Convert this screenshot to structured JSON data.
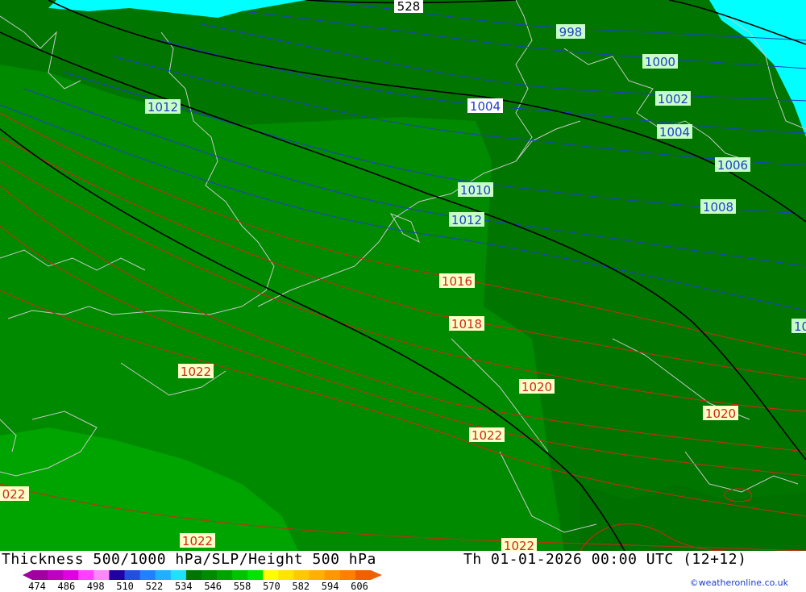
{
  "header": {
    "title": "Thickness 500/1000 hPa/SLP/Height 500 hPa",
    "datetime": "Th 01-01-2026 00:00 UTC (12+12)",
    "credit": "©weatheronline.co.uk"
  },
  "colors": {
    "band_dark": "#007600",
    "band_mid": "#008a00",
    "band_light": "#00a400",
    "band_lightest": "#00b800",
    "cyan": "#00ffff",
    "isobar_blue": "#2040c8",
    "isobar_red": "#d02818",
    "height_line": "#000000",
    "coastline": "#c8c8c8"
  },
  "legend": {
    "ticks": [
      "474",
      "486",
      "498",
      "510",
      "522",
      "534",
      "546",
      "558",
      "570",
      "582",
      "594",
      "606"
    ],
    "swatches": [
      "#a000a0",
      "#c000c0",
      "#e000e0",
      "#ff40ff",
      "#ff88ff",
      "#2000a0",
      "#2050e0",
      "#2080ff",
      "#20b0ff",
      "#20e0ff",
      "#007600",
      "#008a00",
      "#00a400",
      "#00c400",
      "#00e400",
      "#ffff00",
      "#ffe400",
      "#ffc800",
      "#ffb000",
      "#ff9800",
      "#ff8000",
      "#f06000"
    ]
  },
  "map_labels": {
    "height_528": "528",
    "p998": "998",
    "p1000": "1000",
    "p1002": "1002",
    "p1004_a": "1004",
    "p1004_b": "1004",
    "p1006": "1006",
    "p1008": "1008",
    "p1010": "1010",
    "p1012_a": "1012",
    "p1012_b": "1012",
    "p1016": "1016",
    "p1018": "1018",
    "p1020_a": "1020",
    "p1020_b": "1020",
    "p1022_a": "1022",
    "p1022_b": "1022",
    "p1022_c": "1022",
    "p1022_d": "022",
    "p1022_e": "1022",
    "p10_edge": "10"
  }
}
